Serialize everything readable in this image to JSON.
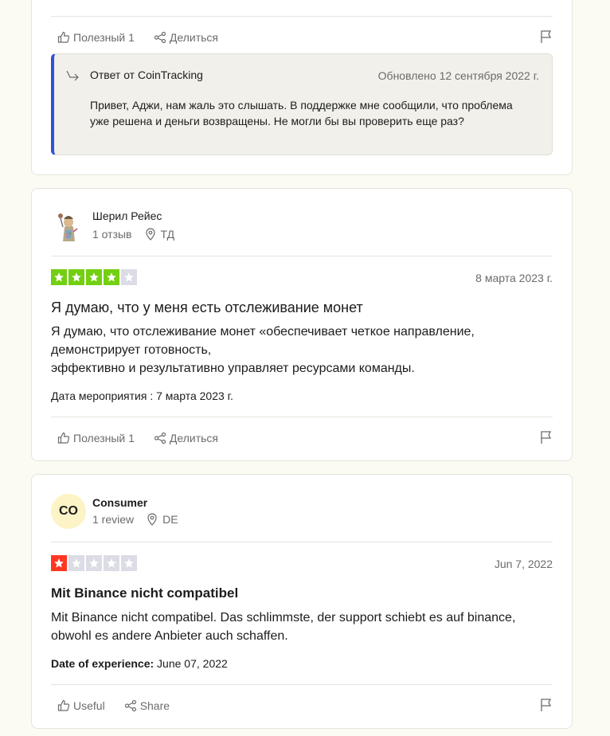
{
  "colors": {
    "page_bg": "#fcfbf3",
    "star_green": "#73cf11",
    "star_red": "#ff3722",
    "star_empty": "#dcdce6",
    "reply_accent": "#3152d8"
  },
  "card1": {
    "useful_label": "Полезный 1",
    "share_label": "Делиться",
    "reply": {
      "title": "Ответ от CoinTracking",
      "date": "Обновлено 12 сентября 2022 г.",
      "text": "Привет, Аджи, нам жаль это слышать. В поддержке мне сообщили, что проблема уже решена и деньги возвращены. Не могли бы вы проверить еще раз?"
    }
  },
  "card2": {
    "reviewer": {
      "name": "Шерил Рейес",
      "reviews": "1 отзыв",
      "location": "ТД"
    },
    "rating": 4,
    "star_color": "green",
    "date": "8 марта 2023 г.",
    "title": "Я думаю, что у меня есть отслеживание монет",
    "body_lines": [
      "Я думаю, что отслеживание монет «обеспечивает четкое направление,",
      "демонстрирует готовность,",
      "эффективно и результативно управляет ресурсами команды."
    ],
    "experience_date": "Дата мероприятия : 7 марта 2023 г.",
    "useful_label": "Полезный 1",
    "share_label": "Делиться"
  },
  "card3": {
    "reviewer": {
      "initials": "CO",
      "name": "Consumer",
      "reviews": "1 review",
      "location": "DE"
    },
    "rating": 1,
    "star_color": "red",
    "date": "Jun 7, 2022",
    "title": "Mit Binance nicht compatibel",
    "body": "Mit Binance nicht compatibel. Das schlimmste, der support schiebt es auf binance, obwohl es andere Anbieter auch schaffen.",
    "experience_label": "Date of experience:",
    "experience_value": " June 07, 2022",
    "useful_label": "Useful",
    "share_label": "Share"
  }
}
